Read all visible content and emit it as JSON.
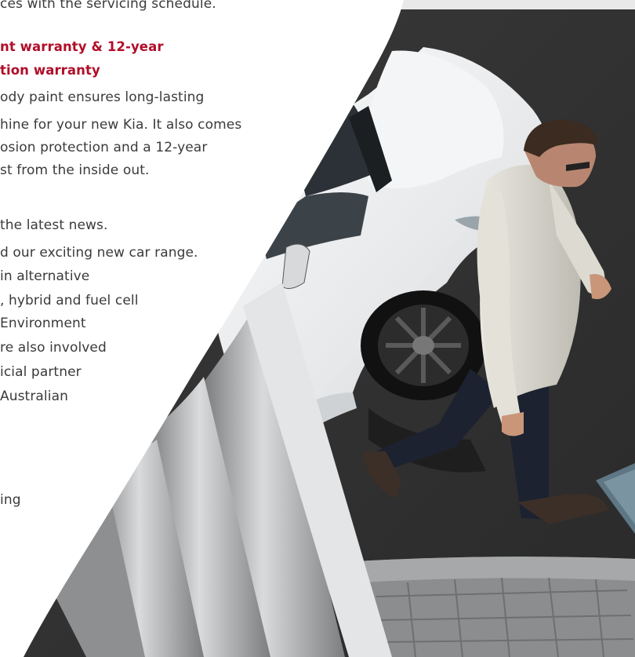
{
  "brochure": {
    "top_fragment": "ces with the servicing schedule.",
    "warranty_heading_line1": "nt warranty & 12-year",
    "warranty_heading_line2": "tion warranty",
    "warranty_body": [
      "ody paint ensures long-lasting",
      "hine for your new Kia. It also comes",
      "osion protection and a 12-year",
      "st from the inside out."
    ],
    "news_body": [
      "the latest news.",
      "d our exciting new car range.",
      " in alternative",
      ", hybrid and fuel cell",
      " Environment",
      "re also involved",
      "icial partner",
      " Australian"
    ],
    "bottom_fragment": "ing",
    "colors": {
      "accent_red": "#b00e2a",
      "panel_white": "#ffffff",
      "body_text": "#3a3a3a"
    }
  }
}
